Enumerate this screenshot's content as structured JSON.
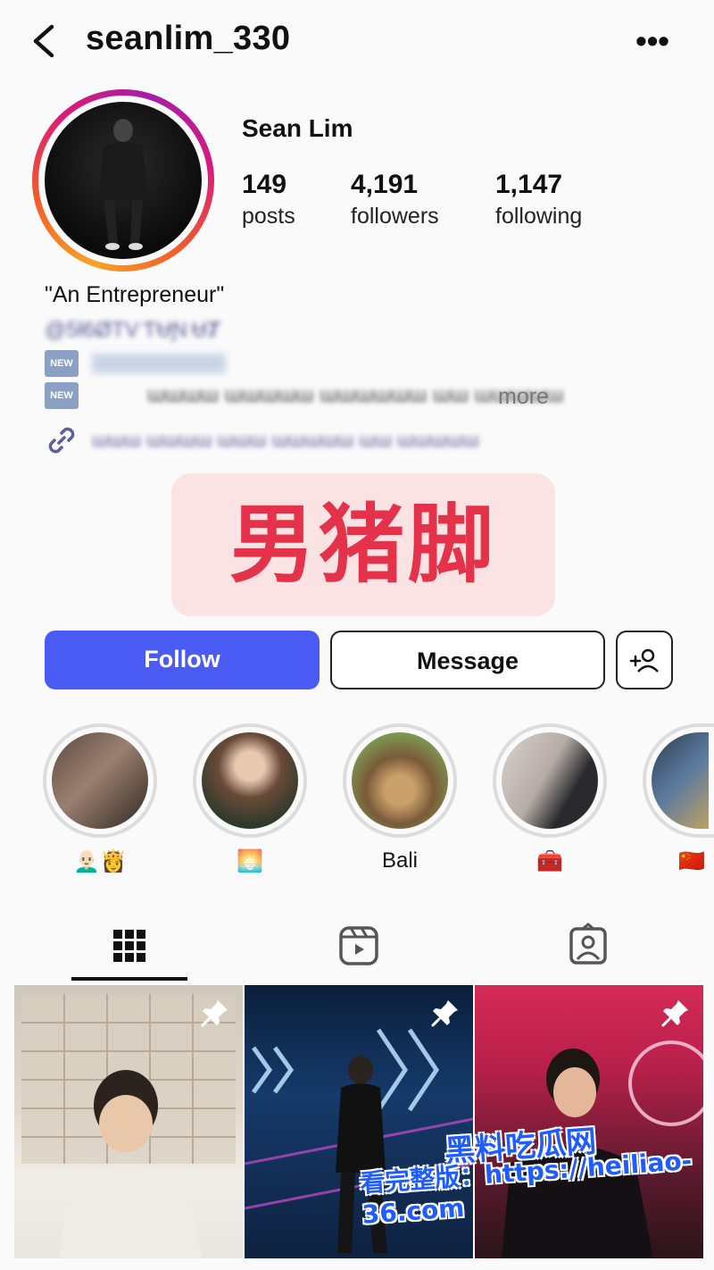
{
  "header": {
    "username": "seanlim_330",
    "back_icon": "chevron-left-icon",
    "more_label": "•••"
  },
  "profile": {
    "display_name": "Sean Lim",
    "stats": [
      {
        "value": "149",
        "label": "posts"
      },
      {
        "value": "4,191",
        "label": "followers"
      },
      {
        "value": "1,147",
        "label": "following"
      }
    ]
  },
  "bio": {
    "line1": "\"An Entrepreneur\"",
    "line2": "@5ƚ6ØTV ƬɄƝ ɄȾ",
    "new_badge": "NEW",
    "line4": "ɯɯɯɯ ɯɯɯɯɯ ɯɯɯɯɯɯ ɯɯ ɯɯɯɯɯ",
    "more": "more",
    "link": "ɯɯɯ ɯɯɯɯ ɯɯɯ ɯɯɯɯɯ ɯɯ ɯɯɯɯɯ"
  },
  "overlay": {
    "text": "男猪脚"
  },
  "actions": {
    "follow": "Follow",
    "message": "Message"
  },
  "highlights": [
    {
      "label": "👨🏻‍🦲👸"
    },
    {
      "label": "🌅"
    },
    {
      "label": "Bali"
    },
    {
      "label": "🧰"
    },
    {
      "label": "🇨🇳"
    }
  ],
  "watermark": {
    "brand": "黑料吃瓜网",
    "url_text": "看完整版：https://heiliao-36.com"
  },
  "colors": {
    "follow_button": "#4a5bf3",
    "overlay_text": "#e5324b",
    "overlay_bg": "#fbe3e3"
  }
}
